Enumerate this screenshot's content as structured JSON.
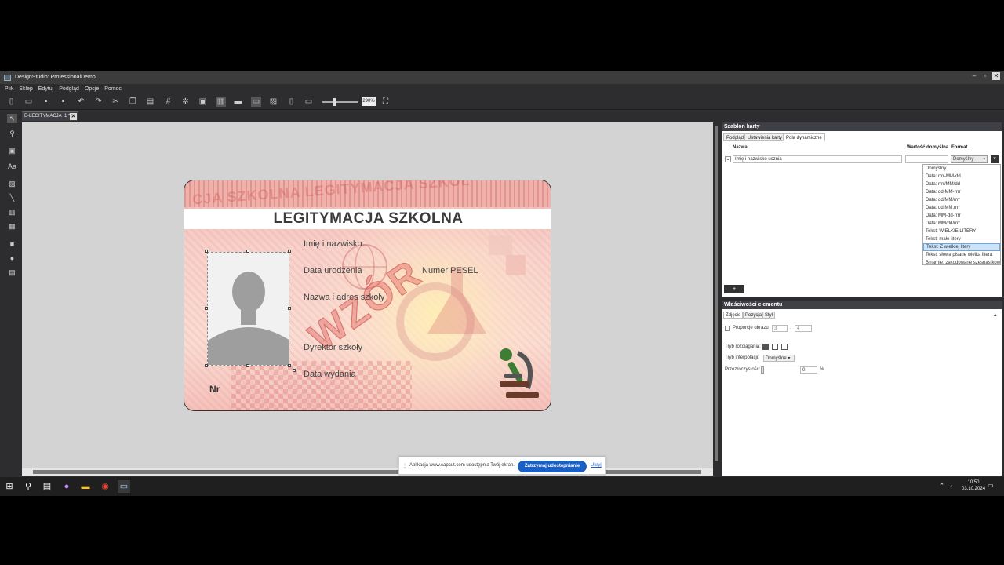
{
  "window": {
    "title": "DesignStudio: ProfessionalDemo"
  },
  "menu": [
    "Plik",
    "Sklep",
    "Edytuj",
    "Podgląd",
    "Opcje",
    "Pomoc"
  ],
  "toolbar": {
    "zoom_value": "290%"
  },
  "document_tab": {
    "label": "E-LEGITYMACJA_1 *"
  },
  "card": {
    "watermark_top": "CJA SZKOLNA LEGITYMACJA SZKOL",
    "title": "LEGITYMACJA SZKOLNA",
    "labels": {
      "name": "Imię i nazwisko",
      "birth": "Data urodzenia",
      "pesel": "Numer PESEL",
      "school": "Nazwa i adres szkoły",
      "director": "Dyrektor szkoły",
      "issue": "Data wydania",
      "nr": "Nr"
    },
    "stamp": "WZÓR"
  },
  "template_panel": {
    "title": "Szablon karty",
    "tabs": [
      "Podgląd",
      "Ustawienia karty",
      "Pola dynamiczne"
    ],
    "columns": {
      "name": "Nazwa",
      "default": "Wartość domyślna",
      "format": "Format"
    },
    "row": {
      "name": "Imię i nazwisko ucznia",
      "format": "Domyślny"
    },
    "format_options": [
      "Domyślny",
      "Data: rrrr-MM-dd",
      "Data: rrrr/MM/dd",
      "Data: dd-MM-rrrr",
      "Data: dd/MM/rrrr",
      "Data: dd.MM.rrrr",
      "Data: MM-dd-rrrr",
      "Data: MM/dd/rrrr",
      "Tekst: WIELKIE LITERY",
      "Tekst: małe litery",
      "Tekst: Z wielkiej litery",
      "Tekst: słowa pisane wielką litera",
      "Binarnie: zakodowane szesnastkowo"
    ],
    "highlighted_option": 10,
    "add_label": "+"
  },
  "properties_panel": {
    "title": "Właściwości elementu",
    "tabs": [
      "Zdjęcie",
      "Pozycja",
      "Styl"
    ],
    "proportions_label": "Proporcje obrazu",
    "proportion_w": "3",
    "proportion_sep": ":",
    "proportion_h": "4",
    "stretch_label": "Tryb rozciągania:",
    "interp_label": "Tryb interpolacji:",
    "interp_value": "Domyślne",
    "opacity_label": "Przezroczystość:",
    "opacity_value": "0",
    "opacity_unit": "%"
  },
  "share_bar": {
    "message": "Aplikacja www.capcut.com udostępnia Twój ekran.",
    "stop_label": "Zatrzymaj udostępnianie",
    "hide_label": "Ukryj"
  },
  "taskbar": {
    "time": "10:50",
    "date": "03.10.2024"
  }
}
